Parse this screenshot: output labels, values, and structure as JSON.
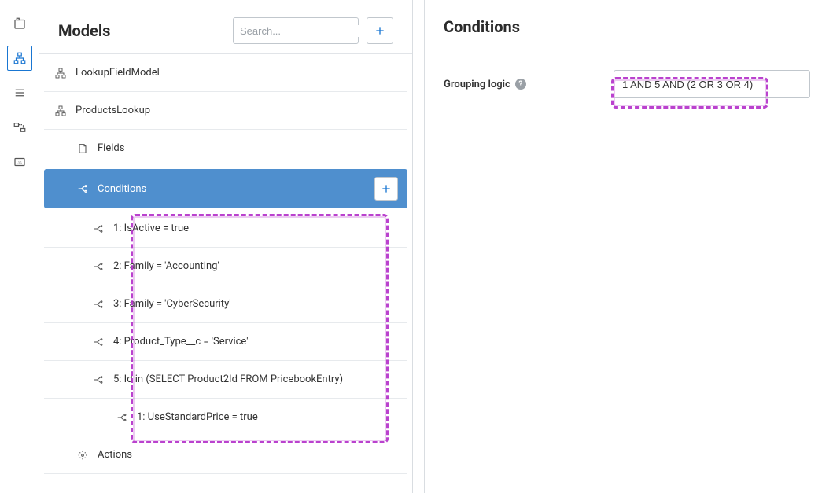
{
  "leftPanel": {
    "title": "Models",
    "search_placeholder": "Search..."
  },
  "models": [
    {
      "label": "LookupFieldModel"
    },
    {
      "label": "ProductsLookup"
    }
  ],
  "productsLookupChildren": {
    "fields_label": "Fields",
    "conditions_label": "Conditions",
    "actions_label": "Actions"
  },
  "conditions": [
    {
      "label": "1: IsActive = true"
    },
    {
      "label": "2: Family = 'Accounting'"
    },
    {
      "label": "3: Family = 'CyberSecurity'"
    },
    {
      "label": "4: Product_Type__c = 'Service'"
    },
    {
      "label": "5: Id in (SELECT Product2Id FROM PricebookEntry)"
    }
  ],
  "subCondition": {
    "label": "1: UseStandardPrice = true"
  },
  "rightPanel": {
    "title": "Conditions",
    "grouping_label": "Grouping logic",
    "grouping_value": "1 AND 5 AND (2 OR 3 OR 4)"
  }
}
